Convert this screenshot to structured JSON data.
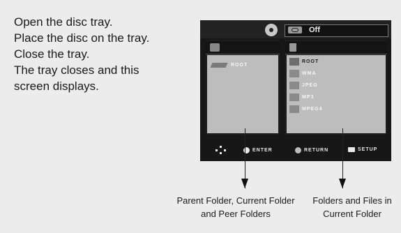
{
  "instructions": {
    "line1": "Open the disc tray.",
    "line2": "Place the disc on the tray.",
    "line3": "Close the tray.",
    "line4": "The tray closes and this",
    "line5": "screen displays."
  },
  "screen": {
    "repeat_status": "Off",
    "left_panel": {
      "entries": [
        "ROOT"
      ]
    },
    "right_panel": {
      "entries": [
        "ROOT",
        "WMA",
        "JPEG",
        "MP3",
        "MPEG4"
      ]
    },
    "bottom_bar": {
      "enter_label": "ENTER",
      "return_label": "RETURN",
      "setup_label": "SETUP"
    }
  },
  "captions": {
    "left_line1": "Parent Folder, Current Folder",
    "left_line2": "and Peer Folders",
    "right_line1": "Folders and Files in",
    "right_line2": "Current Folder"
  }
}
